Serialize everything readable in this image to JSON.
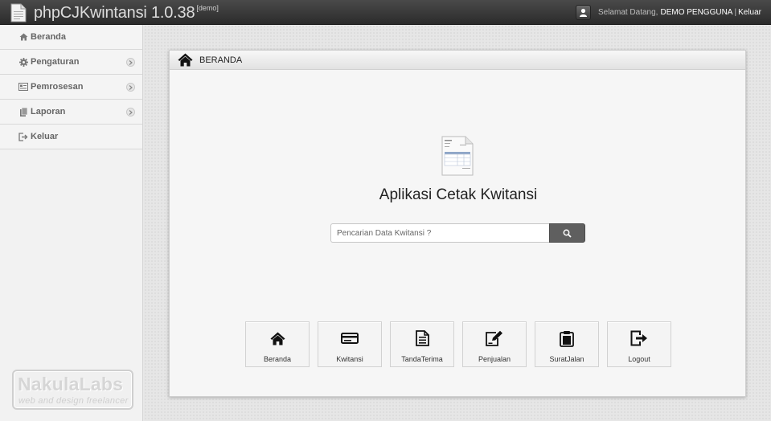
{
  "app": {
    "name": "phpCJKwintansi 1.0.38",
    "tag": "[demo]"
  },
  "user": {
    "greeting": "Selamat Datang,",
    "name": "DEMO PENGGUNA",
    "separator": "|",
    "logout": "Keluar"
  },
  "sidebar": {
    "items": [
      {
        "label": "Beranda",
        "icon": "home-icon",
        "has_submenu": false
      },
      {
        "label": "Pengaturan",
        "icon": "gear-icon",
        "has_submenu": true
      },
      {
        "label": "Pemrosesan",
        "icon": "list-icon",
        "has_submenu": true
      },
      {
        "label": "Laporan",
        "icon": "report-icon",
        "has_submenu": true
      },
      {
        "label": "Keluar",
        "icon": "logout-icon",
        "has_submenu": false
      }
    ],
    "logo": {
      "name": "NakulaLabs",
      "tagline": "web and design freelancer"
    }
  },
  "panel": {
    "title": "BERANDA",
    "heading": "Aplikasi Cetak Kwitansi",
    "search_placeholder": "Pencarian Data Kwitansi ?"
  },
  "tiles": [
    {
      "label": "Beranda",
      "icon": "home-icon"
    },
    {
      "label": "Kwitansi",
      "icon": "credit-card-icon"
    },
    {
      "label": "TandaTerima",
      "icon": "document-icon"
    },
    {
      "label": "Penjualan",
      "icon": "edit-icon"
    },
    {
      "label": "SuratJalan",
      "icon": "clipboard-icon"
    },
    {
      "label": "Logout",
      "icon": "logout-icon"
    }
  ],
  "colors": {
    "topbar": "#2f2f2f",
    "sidebar": "#f2f2f2",
    "panel": "#f6f6f6",
    "search_button": "#5f5f5f"
  }
}
